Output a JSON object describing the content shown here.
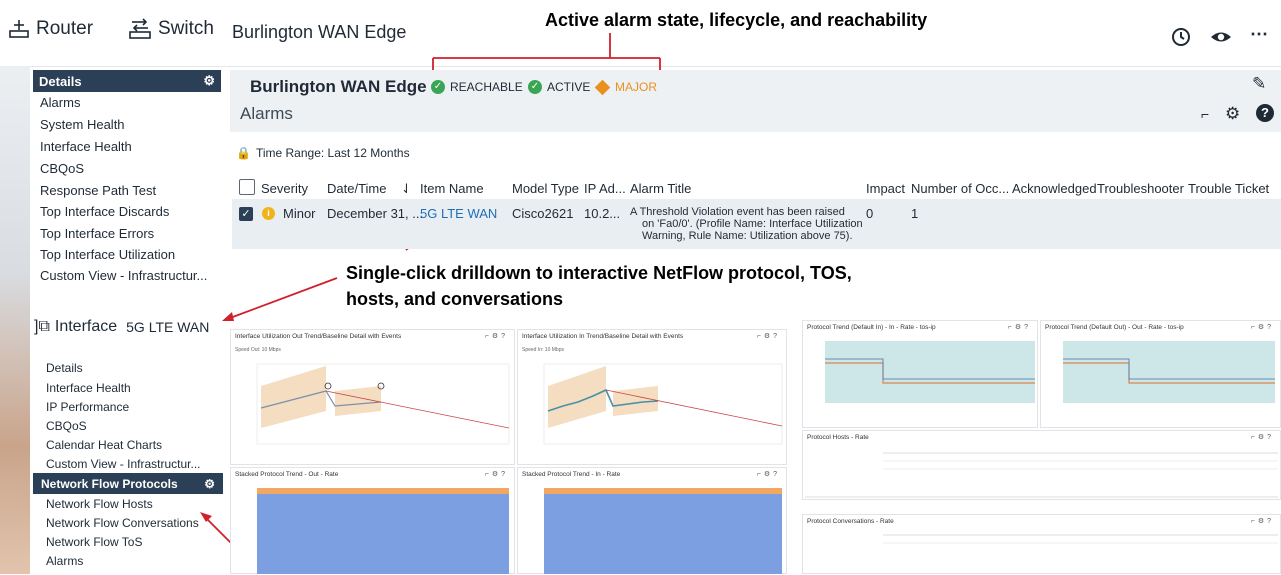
{
  "topbar": {
    "router_label": "Router",
    "switch_label": "Switch",
    "title": "Burlington WAN Edge"
  },
  "callouts": {
    "alarm_state": "Active alarm state, lifecycle, and reachability",
    "drilldown_line1": "Single-click drilldown to interactive NetFlow protocol, TOS,",
    "drilldown_line2": "hosts, and conversations"
  },
  "sidebar": {
    "header": "Details",
    "items": [
      "Alarms",
      "System Health",
      "Interface Health",
      "CBQoS",
      "Response Path Test",
      "Top Interface Discards",
      "Top Interface Errors",
      "Top Interface Utilization",
      "Custom View - Infrastructur..."
    ]
  },
  "interface": {
    "prefix": "Interface",
    "name": "5G LTE WAN",
    "items_before": [
      "Details",
      "Interface Health",
      "IP Performance",
      "CBQoS",
      "Calendar Heat Charts",
      "Custom View - Infrastructur..."
    ],
    "active": "Network Flow Protocols",
    "items_after": [
      "Network Flow Hosts",
      "Network Flow Conversations",
      "Network Flow ToS",
      "Alarms"
    ]
  },
  "device": {
    "name": "Burlington WAN Edge",
    "reachable": "REACHABLE",
    "active": "ACTIVE",
    "severity": "MAJOR"
  },
  "alarms": {
    "title": "Alarms",
    "time_range": "Time Range: Last 12 Months",
    "columns": [
      "Severity",
      "Date/Time",
      "Item Name",
      "Model Type",
      "IP Ad...",
      "Alarm Title",
      "Impact",
      "Number of Occ...",
      "Acknowledged",
      "Troubleshooter",
      "Trouble Ticket ID"
    ],
    "row": {
      "severity": "Minor",
      "datetime": "December 31, ...",
      "item": "5G LTE WAN",
      "model": "Cisco2621",
      "ip": "10.2...",
      "title_l1": "A Threshold Violation event has been raised",
      "title_l2": "on 'Fa0/0'. (Profile Name: Interface Utilization",
      "title_l3": "Warning, Rule Name: Utilization above 75).",
      "impact": "0",
      "occurrences": "1"
    }
  },
  "charts": {
    "util_out": "Interface Utilization Out Trend/Baseline Detail with Events",
    "util_in": "Interface Utilization In Trend/Baseline Detail with Events",
    "speed_out": "Speed Out: 10 Mbps",
    "speed_in": "Speed In: 10 Mbps",
    "stack_out": "Stacked Protocol Trend - Out - Rate",
    "stack_in": "Stacked Protocol Trend - In - Rate",
    "proto_in": "Protocol Trend (Default In) - In - Rate - tos-ip",
    "proto_out": "Protocol Trend (Default Out) - Out - Rate - tos-ip",
    "hosts": "Protocol Hosts - Rate",
    "conversations": "Protocol Conversations - Rate"
  },
  "colors": {
    "navy": "#2b4057",
    "green": "#3aa655",
    "orange": "#e8911e",
    "link": "#1f6fb5",
    "callout_red": "#d0202a"
  }
}
